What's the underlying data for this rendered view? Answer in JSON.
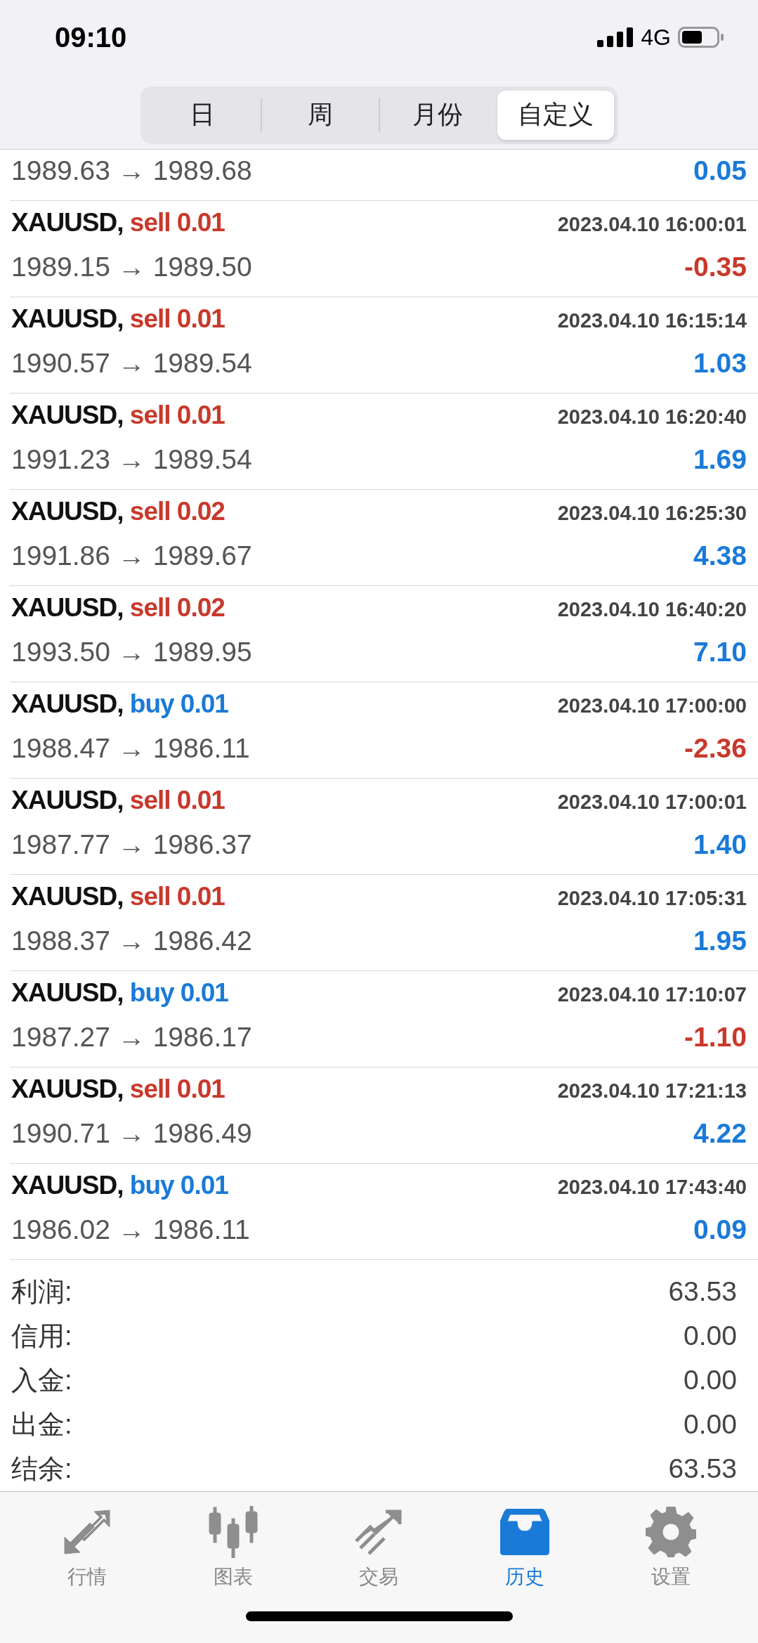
{
  "status_bar": {
    "time": "09:10",
    "network": "4G"
  },
  "segments": [
    {
      "label": "日",
      "selected": false
    },
    {
      "label": "周",
      "selected": false
    },
    {
      "label": "月份",
      "selected": false
    },
    {
      "label": "自定义",
      "selected": true
    }
  ],
  "partial_deal": {
    "prices": "1989.63 → 1989.68",
    "profit": "0.05",
    "negative": false
  },
  "deals": [
    {
      "symbol": "XAUUSD,",
      "kind": "sell",
      "order": "sell 0.01",
      "time": "2023.04.10 16:00:01",
      "prices": "1989.15 → 1989.50",
      "profit": "-0.35",
      "negative": true
    },
    {
      "symbol": "XAUUSD,",
      "kind": "sell",
      "order": "sell 0.01",
      "time": "2023.04.10 16:15:14",
      "prices": "1990.57 → 1989.54",
      "profit": "1.03",
      "negative": false
    },
    {
      "symbol": "XAUUSD,",
      "kind": "sell",
      "order": "sell 0.01",
      "time": "2023.04.10 16:20:40",
      "prices": "1991.23 → 1989.54",
      "profit": "1.69",
      "negative": false
    },
    {
      "symbol": "XAUUSD,",
      "kind": "sell",
      "order": "sell 0.02",
      "time": "2023.04.10 16:25:30",
      "prices": "1991.86 → 1989.67",
      "profit": "4.38",
      "negative": false
    },
    {
      "symbol": "XAUUSD,",
      "kind": "sell",
      "order": "sell 0.02",
      "time": "2023.04.10 16:40:20",
      "prices": "1993.50 → 1989.95",
      "profit": "7.10",
      "negative": false
    },
    {
      "symbol": "XAUUSD,",
      "kind": "buy",
      "order": "buy 0.01",
      "time": "2023.04.10 17:00:00",
      "prices": "1988.47 → 1986.11",
      "profit": "-2.36",
      "negative": true
    },
    {
      "symbol": "XAUUSD,",
      "kind": "sell",
      "order": "sell 0.01",
      "time": "2023.04.10 17:00:01",
      "prices": "1987.77 → 1986.37",
      "profit": "1.40",
      "negative": false
    },
    {
      "symbol": "XAUUSD,",
      "kind": "sell",
      "order": "sell 0.01",
      "time": "2023.04.10 17:05:31",
      "prices": "1988.37 → 1986.42",
      "profit": "1.95",
      "negative": false
    },
    {
      "symbol": "XAUUSD,",
      "kind": "buy",
      "order": "buy 0.01",
      "time": "2023.04.10 17:10:07",
      "prices": "1987.27 → 1986.17",
      "profit": "-1.10",
      "negative": true
    },
    {
      "symbol": "XAUUSD,",
      "kind": "sell",
      "order": "sell 0.01",
      "time": "2023.04.10 17:21:13",
      "prices": "1990.71 → 1986.49",
      "profit": "4.22",
      "negative": false
    },
    {
      "symbol": "XAUUSD,",
      "kind": "buy",
      "order": "buy 0.01",
      "time": "2023.04.10 17:43:40",
      "prices": "1986.02 → 1986.11",
      "profit": "0.09",
      "negative": false
    }
  ],
  "summary": [
    {
      "label": "利润:",
      "value": "63.53"
    },
    {
      "label": "信用:",
      "value": "0.00"
    },
    {
      "label": "入金:",
      "value": "0.00"
    },
    {
      "label": "出金:",
      "value": "0.00"
    },
    {
      "label": "结余:",
      "value": "63.53"
    }
  ],
  "tab_bar": [
    {
      "kind": "quotes",
      "label": "行情",
      "selected": false
    },
    {
      "kind": "chart",
      "label": "图表",
      "selected": false
    },
    {
      "kind": "trade",
      "label": "交易",
      "selected": false
    },
    {
      "kind": "history",
      "label": "历史",
      "selected": true
    },
    {
      "kind": "settings",
      "label": "设置",
      "selected": false
    }
  ]
}
